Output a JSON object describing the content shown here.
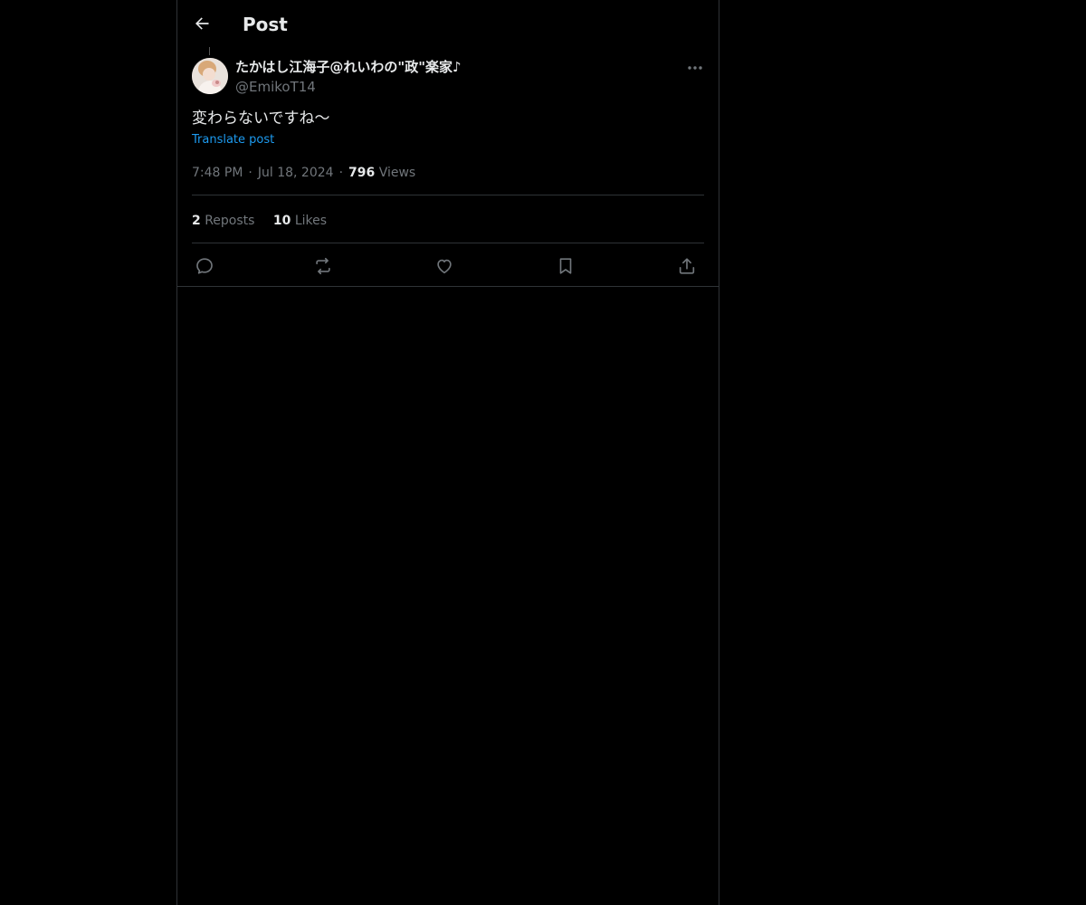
{
  "header": {
    "title": "Post",
    "back_icon": "arrow-left-icon"
  },
  "post": {
    "author_name": "たかはし江海子@れいわの\"政\"楽家♪",
    "author_handle": "@EmikoT14",
    "text": "変わらないですね〜",
    "translate_label": "Translate post",
    "time": "7:48 PM",
    "date": "Jul 18, 2024",
    "views_count": "796",
    "views_label": "Views",
    "reposts_count": "2",
    "reposts_label": "Reposts",
    "likes_count": "10",
    "likes_label": "Likes"
  },
  "actions": [
    "reply-icon",
    "repost-icon",
    "like-icon",
    "bookmark-icon",
    "share-icon"
  ],
  "colors": {
    "background": "#000000",
    "text": "#e7e9ea",
    "muted": "#71767b",
    "accent": "#1d9bf0",
    "border": "#2f3336"
  }
}
